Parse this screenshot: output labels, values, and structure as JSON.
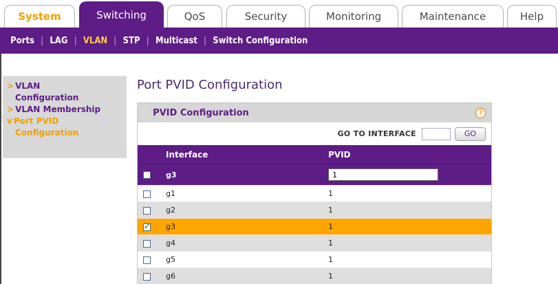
{
  "tabs": [
    {
      "label": "System"
    },
    {
      "label": "Switching"
    },
    {
      "label": "QoS"
    },
    {
      "label": "Security"
    },
    {
      "label": "Monitoring"
    },
    {
      "label": "Maintenance"
    },
    {
      "label": "Help"
    }
  ],
  "subnav": [
    "Ports",
    "LAG",
    "VLAN",
    "STP",
    "Multicast",
    "Switch Configuration"
  ],
  "sidemenu": {
    "vlan_config_1": "VLAN",
    "vlan_config_2": "Configuration",
    "vlan_membership": "VLAN Membership",
    "port_pvid_1": "Port PVID",
    "port_pvid_2": "Configuration"
  },
  "page_title": "Port PVID Configuration",
  "panel": {
    "title": "PVID Configuration",
    "help": "?",
    "goto_label": "GO TO INTERFACE",
    "go_button": "GO"
  },
  "table": {
    "headers": [
      "Interface",
      "PVID"
    ],
    "edit_row": {
      "interface": "g3",
      "pvid": "1"
    },
    "rows": [
      {
        "interface": "g1",
        "pvid": "1",
        "checked": false
      },
      {
        "interface": "g2",
        "pvid": "1",
        "checked": false
      },
      {
        "interface": "g3",
        "pvid": "1",
        "checked": true
      },
      {
        "interface": "g4",
        "pvid": "1",
        "checked": false
      },
      {
        "interface": "g5",
        "pvid": "1",
        "checked": false
      },
      {
        "interface": "g6",
        "pvid": "1",
        "checked": false
      }
    ]
  },
  "colors": {
    "brand_purple": "#5e1c86",
    "accent_orange": "#ffa500"
  }
}
